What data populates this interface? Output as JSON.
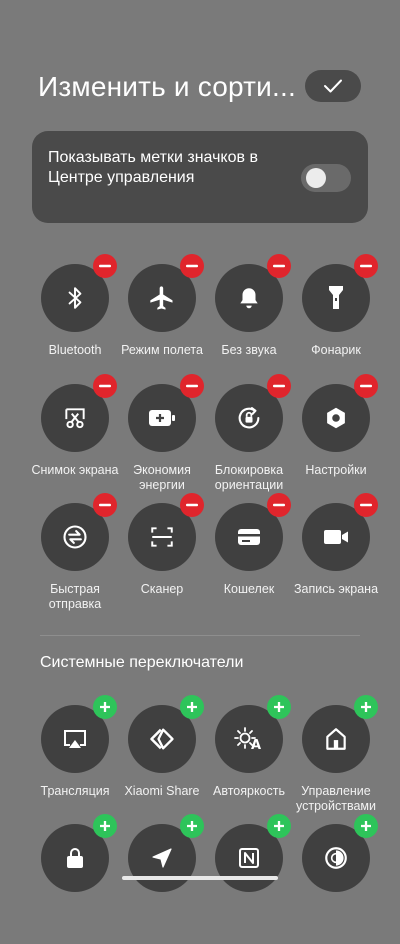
{
  "header": {
    "title": "Изменить и сорти..."
  },
  "settings_card": {
    "text": "Показывать метки значков в Центре управления",
    "toggle_on": false
  },
  "active_tiles": [
    {
      "label": "Bluetooth",
      "icon": "bluetooth-icon"
    },
    {
      "label": "Режим полета",
      "icon": "airplane-icon"
    },
    {
      "label": "Без звука",
      "icon": "bell-icon"
    },
    {
      "label": "Фонарик",
      "icon": "flashlight-icon"
    },
    {
      "label": "Снимок экрана",
      "icon": "screenshot-icon"
    },
    {
      "label": "Экономия энергии",
      "icon": "battery-saver-icon"
    },
    {
      "label": "Блокировка ориентации",
      "icon": "rotation-lock-icon"
    },
    {
      "label": "Настройки",
      "icon": "settings-icon"
    },
    {
      "label": "Быстрая отправка",
      "icon": "quick-send-icon"
    },
    {
      "label": "Сканер",
      "icon": "scanner-icon"
    },
    {
      "label": "Кошелек",
      "icon": "wallet-icon"
    },
    {
      "label": "Запись экрана",
      "icon": "screen-record-icon"
    }
  ],
  "system_section": {
    "title": "Системные переключатели"
  },
  "system_tiles": [
    {
      "label": "Трансляция",
      "icon": "cast-icon"
    },
    {
      "label": "Xiaomi Share",
      "icon": "xiaomi-share-icon"
    },
    {
      "label": "Автояркость",
      "icon": "auto-brightness-icon"
    },
    {
      "label": "Управление устройствами",
      "icon": "device-control-icon"
    },
    {
      "label": "",
      "icon": "lock-icon"
    },
    {
      "label": "",
      "icon": "location-icon"
    },
    {
      "label": "",
      "icon": "nfc-icon"
    },
    {
      "label": "",
      "icon": "contrast-icon"
    }
  ],
  "colors": {
    "background": "#7a7a7a",
    "tile": "#404040",
    "remove_badge": "#e0252c",
    "add_badge": "#2ec45a"
  }
}
